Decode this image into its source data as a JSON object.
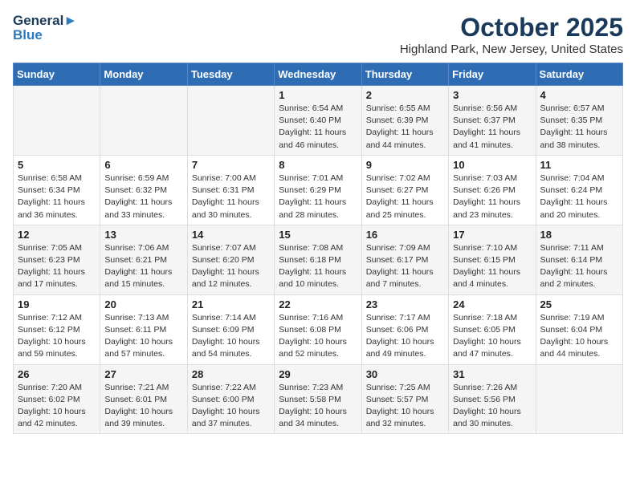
{
  "logo": {
    "line1": "General",
    "line2": "Blue"
  },
  "title": "October 2025",
  "location": "Highland Park, New Jersey, United States",
  "days_of_week": [
    "Sunday",
    "Monday",
    "Tuesday",
    "Wednesday",
    "Thursday",
    "Friday",
    "Saturday"
  ],
  "weeks": [
    [
      {
        "day": "",
        "content": ""
      },
      {
        "day": "",
        "content": ""
      },
      {
        "day": "",
        "content": ""
      },
      {
        "day": "1",
        "content": "Sunrise: 6:54 AM\nSunset: 6:40 PM\nDaylight: 11 hours\nand 46 minutes."
      },
      {
        "day": "2",
        "content": "Sunrise: 6:55 AM\nSunset: 6:39 PM\nDaylight: 11 hours\nand 44 minutes."
      },
      {
        "day": "3",
        "content": "Sunrise: 6:56 AM\nSunset: 6:37 PM\nDaylight: 11 hours\nand 41 minutes."
      },
      {
        "day": "4",
        "content": "Sunrise: 6:57 AM\nSunset: 6:35 PM\nDaylight: 11 hours\nand 38 minutes."
      }
    ],
    [
      {
        "day": "5",
        "content": "Sunrise: 6:58 AM\nSunset: 6:34 PM\nDaylight: 11 hours\nand 36 minutes."
      },
      {
        "day": "6",
        "content": "Sunrise: 6:59 AM\nSunset: 6:32 PM\nDaylight: 11 hours\nand 33 minutes."
      },
      {
        "day": "7",
        "content": "Sunrise: 7:00 AM\nSunset: 6:31 PM\nDaylight: 11 hours\nand 30 minutes."
      },
      {
        "day": "8",
        "content": "Sunrise: 7:01 AM\nSunset: 6:29 PM\nDaylight: 11 hours\nand 28 minutes."
      },
      {
        "day": "9",
        "content": "Sunrise: 7:02 AM\nSunset: 6:27 PM\nDaylight: 11 hours\nand 25 minutes."
      },
      {
        "day": "10",
        "content": "Sunrise: 7:03 AM\nSunset: 6:26 PM\nDaylight: 11 hours\nand 23 minutes."
      },
      {
        "day": "11",
        "content": "Sunrise: 7:04 AM\nSunset: 6:24 PM\nDaylight: 11 hours\nand 20 minutes."
      }
    ],
    [
      {
        "day": "12",
        "content": "Sunrise: 7:05 AM\nSunset: 6:23 PM\nDaylight: 11 hours\nand 17 minutes."
      },
      {
        "day": "13",
        "content": "Sunrise: 7:06 AM\nSunset: 6:21 PM\nDaylight: 11 hours\nand 15 minutes."
      },
      {
        "day": "14",
        "content": "Sunrise: 7:07 AM\nSunset: 6:20 PM\nDaylight: 11 hours\nand 12 minutes."
      },
      {
        "day": "15",
        "content": "Sunrise: 7:08 AM\nSunset: 6:18 PM\nDaylight: 11 hours\nand 10 minutes."
      },
      {
        "day": "16",
        "content": "Sunrise: 7:09 AM\nSunset: 6:17 PM\nDaylight: 11 hours\nand 7 minutes."
      },
      {
        "day": "17",
        "content": "Sunrise: 7:10 AM\nSunset: 6:15 PM\nDaylight: 11 hours\nand 4 minutes."
      },
      {
        "day": "18",
        "content": "Sunrise: 7:11 AM\nSunset: 6:14 PM\nDaylight: 11 hours\nand 2 minutes."
      }
    ],
    [
      {
        "day": "19",
        "content": "Sunrise: 7:12 AM\nSunset: 6:12 PM\nDaylight: 10 hours\nand 59 minutes."
      },
      {
        "day": "20",
        "content": "Sunrise: 7:13 AM\nSunset: 6:11 PM\nDaylight: 10 hours\nand 57 minutes."
      },
      {
        "day": "21",
        "content": "Sunrise: 7:14 AM\nSunset: 6:09 PM\nDaylight: 10 hours\nand 54 minutes."
      },
      {
        "day": "22",
        "content": "Sunrise: 7:16 AM\nSunset: 6:08 PM\nDaylight: 10 hours\nand 52 minutes."
      },
      {
        "day": "23",
        "content": "Sunrise: 7:17 AM\nSunset: 6:06 PM\nDaylight: 10 hours\nand 49 minutes."
      },
      {
        "day": "24",
        "content": "Sunrise: 7:18 AM\nSunset: 6:05 PM\nDaylight: 10 hours\nand 47 minutes."
      },
      {
        "day": "25",
        "content": "Sunrise: 7:19 AM\nSunset: 6:04 PM\nDaylight: 10 hours\nand 44 minutes."
      }
    ],
    [
      {
        "day": "26",
        "content": "Sunrise: 7:20 AM\nSunset: 6:02 PM\nDaylight: 10 hours\nand 42 minutes."
      },
      {
        "day": "27",
        "content": "Sunrise: 7:21 AM\nSunset: 6:01 PM\nDaylight: 10 hours\nand 39 minutes."
      },
      {
        "day": "28",
        "content": "Sunrise: 7:22 AM\nSunset: 6:00 PM\nDaylight: 10 hours\nand 37 minutes."
      },
      {
        "day": "29",
        "content": "Sunrise: 7:23 AM\nSunset: 5:58 PM\nDaylight: 10 hours\nand 34 minutes."
      },
      {
        "day": "30",
        "content": "Sunrise: 7:25 AM\nSunset: 5:57 PM\nDaylight: 10 hours\nand 32 minutes."
      },
      {
        "day": "31",
        "content": "Sunrise: 7:26 AM\nSunset: 5:56 PM\nDaylight: 10 hours\nand 30 minutes."
      },
      {
        "day": "",
        "content": ""
      }
    ]
  ]
}
